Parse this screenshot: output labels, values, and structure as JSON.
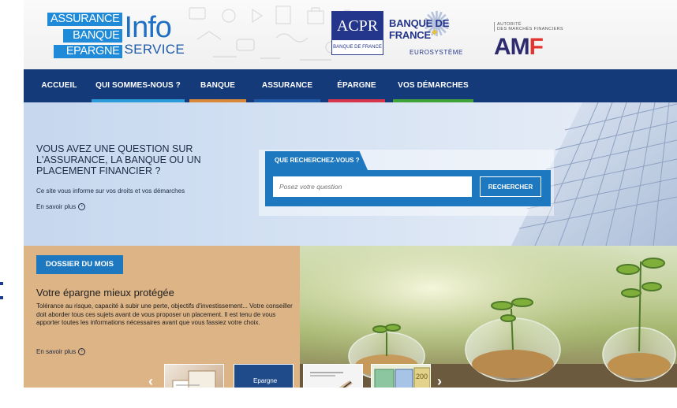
{
  "header": {
    "logo": {
      "line1": "ASSURANCE",
      "line2": "BANQUE",
      "line3": "EPARGNE",
      "info": "Info",
      "service": "SERVICE"
    },
    "acpr": {
      "main": "ACPR",
      "sub": "BANQUE DE FRANCE"
    },
    "bdf": {
      "title": "BANQUE DE FRANCE",
      "sub": "EUROSYSTÈME"
    },
    "amf": {
      "small1": "AUTORITÉ",
      "small2": "DES MARCHÉS FINANCIERS",
      "big_a": "AM",
      "big_f": "F"
    }
  },
  "nav": {
    "items": [
      {
        "label": "ACCUEIL",
        "color": ""
      },
      {
        "label": "QUI SOMMES-NOUS ?",
        "color": "#2a9ad8"
      },
      {
        "label": "BANQUE",
        "color": "#d9883a"
      },
      {
        "label": "ASSURANCE",
        "color": "#1e5aa8"
      },
      {
        "label": "ÉPARGNE",
        "color": "#d9354a"
      },
      {
        "label": "VOS DÉMARCHES",
        "color": "#3fa33a"
      }
    ]
  },
  "hero": {
    "title": "VOUS AVEZ UNE QUESTION SUR L'ASSURANCE, LA BANQUE OU UN PLACEMENT FINANCIER ?",
    "description": "Ce site vous informe sur vos droits et vos démarches",
    "more": "En savoir plus"
  },
  "search": {
    "tab_label": "QUE RECHERCHEZ-VOUS ?",
    "placeholder": "Posez votre question",
    "button_label": "RECHERCHER"
  },
  "dossier": {
    "badge": "DOSSIER DU MOIS",
    "title": "Votre épargne mieux protégée",
    "text": "Tolérance au risque, capacité à subir une perte, objectifs d'investissement... Votre conseiller doit aborder tous ces sujets avant de vous proposer un placement. Il est tenu de vous apporter toutes les informations nécessaires avant que vous fassiez votre choix.",
    "more": "En savoir plus"
  },
  "carousel": {
    "prev": "‹",
    "next": "›",
    "thumb2_label": "Epargne"
  },
  "colors": {
    "nav_bg": "#153a7a",
    "accent_blue": "#1e78c0",
    "dossier_bg": "#ddb486"
  }
}
